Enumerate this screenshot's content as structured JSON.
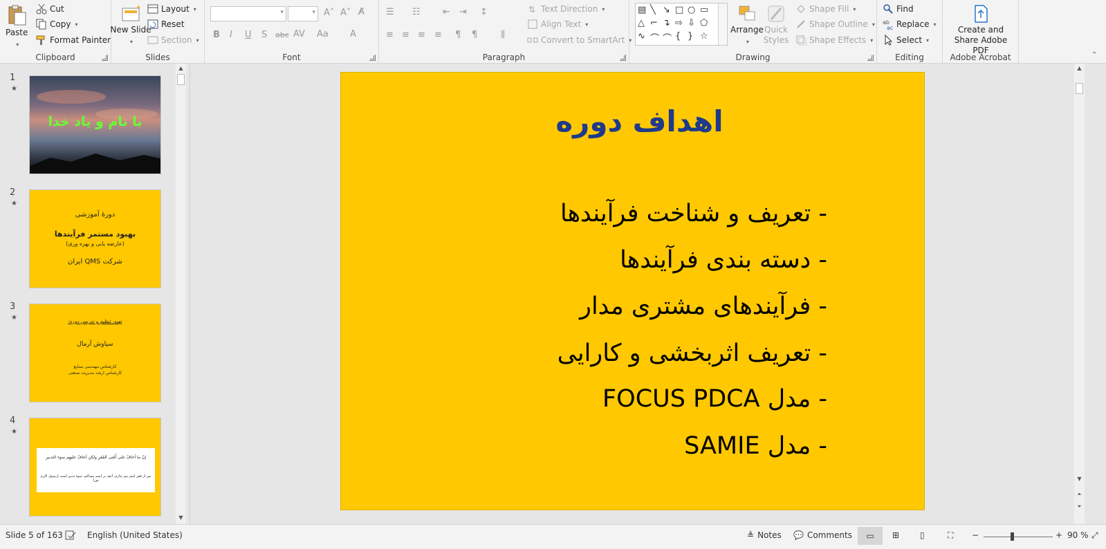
{
  "ribbon": {
    "clipboard": {
      "label": "Clipboard",
      "paste": "Paste",
      "cut": "Cut",
      "copy": "Copy",
      "format_painter": "Format Painter"
    },
    "slides": {
      "label": "Slides",
      "new_slide": "New Slide",
      "layout": "Layout",
      "reset": "Reset",
      "section": "Section"
    },
    "font": {
      "label": "Font"
    },
    "paragraph": {
      "label": "Paragraph",
      "text_direction": "Text Direction",
      "align_text": "Align Text",
      "convert_smartart": "Convert to SmartArt"
    },
    "drawing": {
      "label": "Drawing",
      "arrange": "Arrange",
      "quick_styles": "Quick Styles",
      "shape_fill": "Shape Fill",
      "shape_outline": "Shape Outline",
      "shape_effects": "Shape Effects"
    },
    "editing": {
      "label": "Editing",
      "find": "Find",
      "replace": "Replace",
      "select": "Select"
    },
    "acrobat": {
      "label": "Adobe Acrobat",
      "create_share": "Create and Share Adobe PDF"
    }
  },
  "thumbnails": [
    {
      "num": "1",
      "title": "با نام و یاد خدا"
    },
    {
      "num": "2",
      "line1": "دورهٔ آموزشی",
      "line2": "بهبود مستمر فرآیندها",
      "line3": "(عارضه یابی و بهره وری)",
      "line4": "شرکت QMS ایران"
    },
    {
      "num": "3",
      "line1": "تهیه، تنظیم و تدریس دوره:",
      "line2": "سیاوش آرمال",
      "line3": "کارشناس مهندسی صنایع",
      "line4": "کارشناس ارشد مدیریت صنعتی"
    },
    {
      "num": "4",
      "line1": "اِنّ ما اَخافُ علی اُمّتی الفَقرِ ولکن اَخافُ علیهِم سوء التدبیر",
      "line2": "من از فقر امتم بیم ندارم، آنچه بر امتم بیمناکم، سوء تدبیر است (رسول اکرم ص)"
    }
  ],
  "slide": {
    "title": "اهداف دوره",
    "bullets": [
      "- تعریف و شناخت فرآیندها",
      "- دسته بندی فرآیندها",
      "- فرآیندهای مشتری مدار",
      "- تعریف اثربخشی و کارایی",
      "- مدل FOCUS PDCA",
      "- مدل SAMIE"
    ]
  },
  "status": {
    "slide_count": "Slide 5 of 163",
    "language": "English (United States)",
    "notes": "Notes",
    "comments": "Comments",
    "zoom": "90 %"
  },
  "colors": {
    "slide_bg": "#ffc800",
    "title": "#1f3a8a",
    "thumb1_text": "#66ff33"
  }
}
